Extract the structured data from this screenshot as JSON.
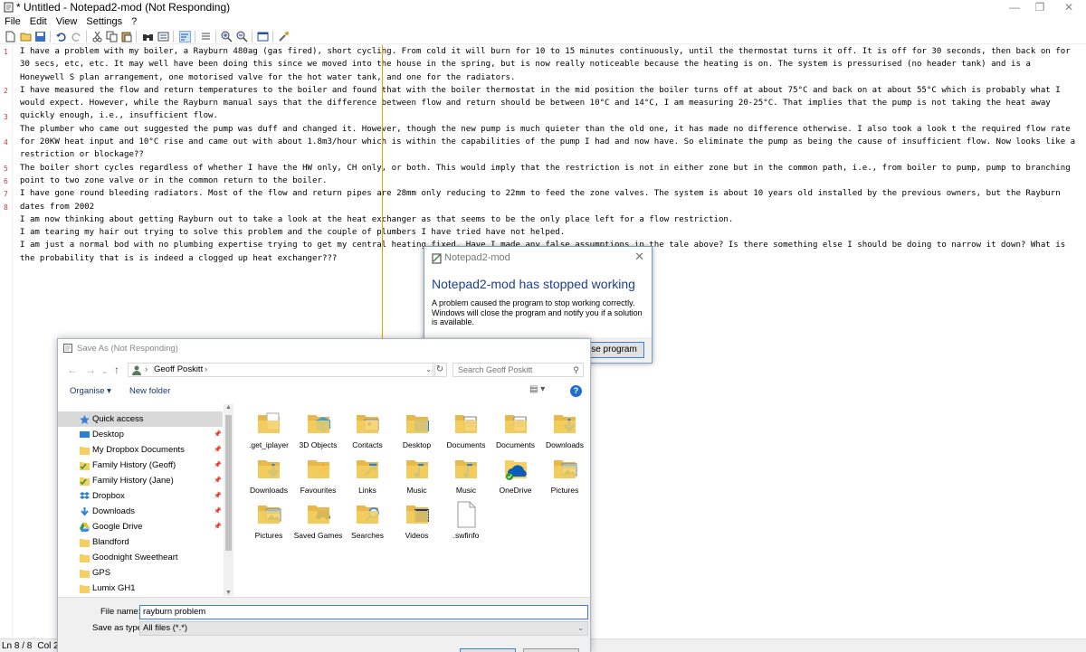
{
  "window": {
    "title": "* Untitled - Notepad2-mod (Not Responding)",
    "minimize": "—",
    "maximize": "❐",
    "close": "✕"
  },
  "menu": [
    "File",
    "Edit",
    "View",
    "Settings",
    "?"
  ],
  "editor": {
    "lines": [
      {
        "number": "1",
        "text": "I have a problem with my boiler, a Rayburn 480ag (gas fired), short cycling. From cold it will burn for 10 to 15 minutes continuously, until the thermostat turns it off. It is off for 30 seconds, then back on for 30 secs, etc, etc. It may well have been doing this since we moved into the house in the spring, but is now really noticeable because the heating is on. The system is pressurised (no header tank) and is a Honeywell S plan arrangement, one motorised valve for the hot water tank, and one for the radiators."
      },
      {
        "number": "2",
        "text": "I have measured the flow and return temperatures to the boiler and found that with the boiler thermostat in the mid position the boiler turns off at about 75°C and back on at about 55°C which is probably what I would expect. However, while the Rayburn manual says that the difference between flow and return should be between 10°C and 14°C, I am measuring 20-25°C. That implies that the pump is not taking the heat away quickly enough, i.e., insufficient flow."
      },
      {
        "number": "3",
        "text": "The plumber who came out suggested the pump was duff and changed it. However, though the new pump is much quieter than the old one, it has made no difference otherwise. I also took a look t the required flow rate for 20KW heat input and 10°C rise and came out with about 1.8m3/hour which is within the capabilities of the pump I had and now have. So eliminate the pump as being the cause of insufficient flow. Now looks like a restriction or blockage??"
      },
      {
        "number": "4",
        "text": "The boiler short cycles regardless of whether I have the HW only, CH only, or both. This would imply that the restriction is not in either zone but in the common path, i.e., from boiler to pump, pump to branching point to two zone valve or in the common return to the boiler."
      },
      {
        "number": "5",
        "text": "I have gone round bleeding radiators. Most of the flow and return pipes are 28mm only reducing to 22mm to feed the zone valves. The system is about 10 years old installed by the previous owners, but the Rayburn dates from 2002"
      },
      {
        "number": "6",
        "text": "I am now thinking about getting Rayburn out to take a look at the heat exchanger as that seems to be the only place left for a flow restriction."
      },
      {
        "number": "7",
        "text": "I am tearing my hair out trying to solve this problem and the couple of plumbers I have tried have not helped."
      },
      {
        "number": "8",
        "text": "I am just a normal bod with no plumbing expertise trying to get my central heating fixed. Have I made any false assumptions in the tale above? Is there something else I should be doing to narrow it down? What is the probability that is is indeed a clogged up heat exchanger???"
      }
    ]
  },
  "status": {
    "position": "Ln 8 / 8",
    "col": "Col 27"
  },
  "error_dialog": {
    "caption": "Notepad2-mod",
    "headline": "Notepad2-mod has stopped working",
    "message": "A problem caused the program to stop working correctly. Windows will close the program and notify you if a solution is available.",
    "button": "Close program",
    "close": "✕"
  },
  "save_dialog": {
    "caption": "Save As (Not Responding)",
    "breadcrumb": "Geoff Poskitt",
    "search_placeholder": "Search Geoff Poskitt",
    "organise": "Organise ▾",
    "new_folder": "New folder",
    "nav_items": [
      {
        "label": "Quick access",
        "icon": "star-icon",
        "pinned": false
      },
      {
        "label": "Desktop",
        "icon": "desktop-icon",
        "pinned": true
      },
      {
        "label": "My Dropbox Documents",
        "icon": "folder-icon",
        "pinned": true
      },
      {
        "label": "Family History (Geoff)",
        "icon": "folder-check-icon",
        "pinned": true
      },
      {
        "label": "Family History (Jane)",
        "icon": "folder-check-icon",
        "pinned": true
      },
      {
        "label": "Dropbox",
        "icon": "dropbox-icon",
        "pinned": true
      },
      {
        "label": "Downloads",
        "icon": "download-icon",
        "pinned": true
      },
      {
        "label": "Google Drive",
        "icon": "google-drive-icon",
        "pinned": true
      },
      {
        "label": "Blandford",
        "icon": "folder-icon",
        "pinned": false
      },
      {
        "label": "Goodnight Sweetheart",
        "icon": "folder-icon",
        "pinned": false
      },
      {
        "label": "GPS",
        "icon": "folder-icon",
        "pinned": false
      },
      {
        "label": "Lumix GH1",
        "icon": "folder-icon",
        "pinned": false
      }
    ],
    "files": [
      {
        "name": ".get_iplayer",
        "icon": "folder-doc-icon"
      },
      {
        "name": "3D Objects",
        "icon": "folder-3d-icon"
      },
      {
        "name": "Contacts",
        "icon": "folder-contacts-icon"
      },
      {
        "name": "Desktop",
        "icon": "folder-desktop-icon"
      },
      {
        "name": "Documents",
        "icon": "folder-documents-icon"
      },
      {
        "name": "Documents",
        "icon": "folder-documents-icon"
      },
      {
        "name": "Downloads",
        "icon": "folder-downloads-icon"
      },
      {
        "name": "Downloads",
        "icon": "folder-downloads-icon"
      },
      {
        "name": "Favourites",
        "icon": "folder-star-icon"
      },
      {
        "name": "Links",
        "icon": "folder-links-icon"
      },
      {
        "name": "Music",
        "icon": "folder-music-icon"
      },
      {
        "name": "Music",
        "icon": "folder-music-icon"
      },
      {
        "name": "OneDrive",
        "icon": "onedrive-icon"
      },
      {
        "name": "Pictures",
        "icon": "folder-pictures-icon"
      },
      {
        "name": "Pictures",
        "icon": "folder-pictures-icon"
      },
      {
        "name": "Saved Games",
        "icon": "folder-games-icon"
      },
      {
        "name": "Searches",
        "icon": "folder-search-icon"
      },
      {
        "name": "Videos",
        "icon": "folder-videos-icon"
      },
      {
        "name": ".swfinfo",
        "icon": "file-icon"
      }
    ],
    "file_name_label": "File name:",
    "file_name_value": "rayburn problem",
    "save_type_label": "Save as type:",
    "save_type_value": "All files (*.*)"
  },
  "colors": {
    "accent": "#3c7fd4",
    "error_headline": "#1c3f94",
    "line_number": "#c04040",
    "edge_line": "#e8a000",
    "folder": "#f5cf62"
  }
}
